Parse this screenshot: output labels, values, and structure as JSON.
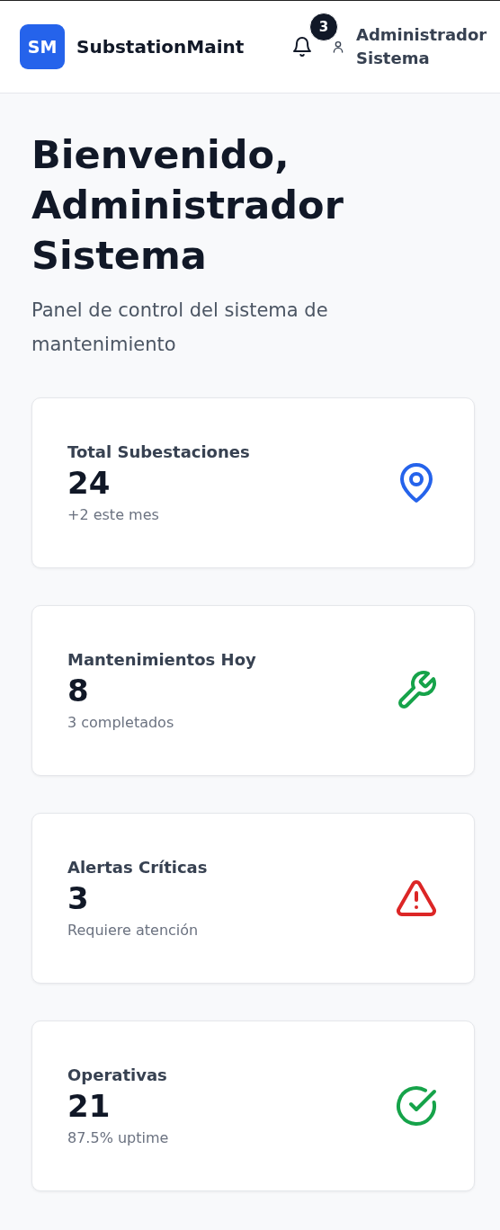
{
  "header": {
    "logo": "SM",
    "app_name": "SubstationMaint",
    "notifications": {
      "count": "3"
    },
    "user": {
      "name": "Administrador Sistema"
    }
  },
  "welcome": {
    "title": "Bienvenido, Administrador Sistema",
    "subtitle": "Panel de control del sistema de mantenimiento"
  },
  "stats": [
    {
      "label": "Total Subestaciones",
      "value": "24",
      "note": "+2 este mes",
      "kind": "location",
      "color": "#2563eb"
    },
    {
      "label": "Mantenimientos Hoy",
      "value": "8",
      "note": "3 completados",
      "kind": "wrench",
      "color": "#16a34a"
    },
    {
      "label": "Alertas Críticas",
      "value": "3",
      "note": "Requiere atención",
      "kind": "alert",
      "color": "#dc2626"
    },
    {
      "label": "Operativas",
      "value": "21",
      "note": "87.5% uptime",
      "kind": "check",
      "color": "#16a34a"
    }
  ]
}
